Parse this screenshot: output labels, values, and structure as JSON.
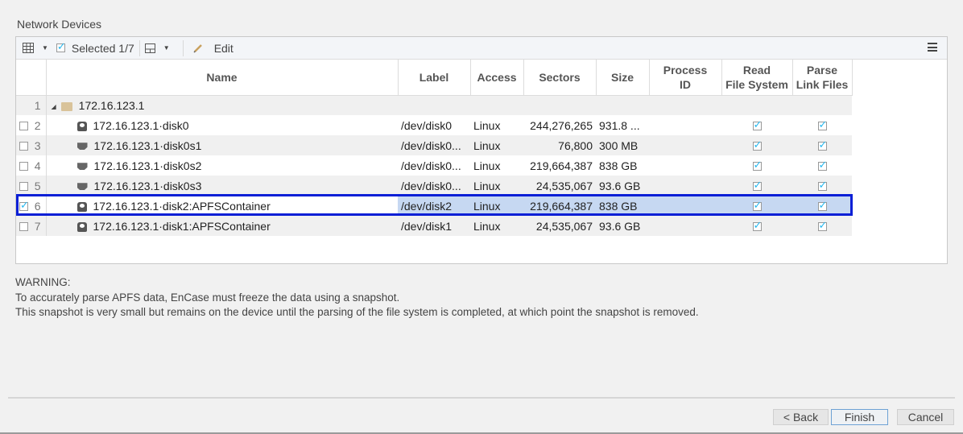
{
  "section_title": "Network Devices",
  "toolbar": {
    "grid_menu_icon": "table-grid-icon",
    "selected_label": "Selected 1/7",
    "layout_menu_icon": "layout-pane-icon",
    "edit_label": "Edit",
    "menu_icon": "hamburger-menu-icon"
  },
  "columns": [
    "Name",
    "Label",
    "Access",
    "Sectors",
    "Size",
    "Process ID",
    "Read File System",
    "Parse Link Files"
  ],
  "columns_lines": {
    "process": [
      "Process",
      "ID"
    ],
    "read": [
      "Read",
      "File System"
    ],
    "parse": [
      "Parse",
      "Link Files"
    ]
  },
  "rows": [
    {
      "num": "1",
      "checkbox": false,
      "has_checkbox": false,
      "icon": "folder-icon",
      "name": "172.16.123.1",
      "label": "",
      "access": "",
      "sectors": "",
      "size": "",
      "process_id": "",
      "read_fs": null,
      "parse_link": null
    },
    {
      "num": "2",
      "checkbox": false,
      "has_checkbox": true,
      "icon": "disk-icon",
      "name": "172.16.123.1·disk0",
      "label": "/dev/disk0",
      "access": "Linux",
      "sectors": "244,276,265",
      "size": "931.8 ...",
      "process_id": "",
      "read_fs": true,
      "parse_link": true
    },
    {
      "num": "3",
      "checkbox": false,
      "has_checkbox": true,
      "icon": "partition-icon",
      "name": "172.16.123.1·disk0s1",
      "label": "/dev/disk0...",
      "access": "Linux",
      "sectors": "76,800",
      "size": "300 MB",
      "process_id": "",
      "read_fs": true,
      "parse_link": true
    },
    {
      "num": "4",
      "checkbox": false,
      "has_checkbox": true,
      "icon": "partition-icon",
      "name": "172.16.123.1·disk0s2",
      "label": "/dev/disk0...",
      "access": "Linux",
      "sectors": "219,664,387",
      "size": "838 GB",
      "process_id": "",
      "read_fs": true,
      "parse_link": true
    },
    {
      "num": "5",
      "checkbox": false,
      "has_checkbox": true,
      "icon": "partition-icon",
      "name": "172.16.123.1·disk0s3",
      "label": "/dev/disk0...",
      "access": "Linux",
      "sectors": "24,535,067",
      "size": "93.6 GB",
      "process_id": "",
      "read_fs": true,
      "parse_link": true
    },
    {
      "num": "6",
      "checkbox": true,
      "has_checkbox": true,
      "icon": "disk-icon",
      "name": "172.16.123.1·disk2:APFSContainer",
      "label": "/dev/disk2",
      "access": "Linux",
      "sectors": "219,664,387",
      "size": "838 GB",
      "process_id": "",
      "read_fs": true,
      "parse_link": true,
      "selected": true
    },
    {
      "num": "7",
      "checkbox": false,
      "has_checkbox": true,
      "icon": "disk-icon",
      "name": "172.16.123.1·disk1:APFSContainer",
      "label": "/dev/disk1",
      "access": "Linux",
      "sectors": "24,535,067",
      "size": "93.6 GB",
      "process_id": "",
      "read_fs": true,
      "parse_link": true
    }
  ],
  "warning": {
    "title": "WARNING:",
    "line1": "To accurately parse APFS data, EnCase must freeze the data using a snapshot.",
    "line2": "This snapshot is very small but remains on the device until the parsing of the file system is completed, at which point the snapshot is removed."
  },
  "buttons": {
    "back": "< Back",
    "finish": "Finish",
    "cancel": "Cancel"
  },
  "colors": {
    "selection_outline": "#0a1fd6",
    "selection_fill": "#c6d8f2",
    "checkbox_check": "#27b8ef"
  }
}
